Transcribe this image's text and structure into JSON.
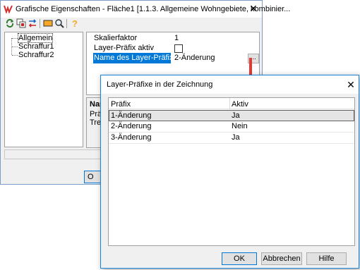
{
  "main_window": {
    "title": "Grafische Eigenschaften - Fläche1 [1.1.3. Allgemeine Wohngebiete, kombinier...",
    "close_label": "✕",
    "toolbar": [
      "refresh-icon",
      "layers-icon",
      "swap-icon",
      "rectangle-icon",
      "zoom-icon",
      "help-icon"
    ],
    "tree": {
      "items": [
        "Allgemein",
        "Schraffur1",
        "Schraffur2"
      ]
    },
    "properties": [
      {
        "name": "Skalierfaktor",
        "value": "1"
      },
      {
        "name": "Layer-Präfix aktiv",
        "value": ""
      },
      {
        "name": "Name des Layer-Präfixes",
        "value": "2-Änderung"
      }
    ],
    "ellipsis_label": "...",
    "description": {
      "title": "Nam",
      "line1": "Präfi",
      "line2": "Tren"
    },
    "ok_label": "O"
  },
  "dialog": {
    "title": "Layer-Präfixe in der Zeichnung",
    "close_label": "✕",
    "columns": [
      "Präfix",
      "Aktiv"
    ],
    "rows": [
      {
        "prefix": "1-Änderung",
        "active": "Ja"
      },
      {
        "prefix": "2-Änderung",
        "active": "Nein"
      },
      {
        "prefix": "3-Änderung",
        "active": "Ja"
      }
    ],
    "buttons": {
      "ok": "OK",
      "cancel": "Abbrechen",
      "help": "Hilfe"
    }
  },
  "colors": {
    "accent": "#0078d7",
    "arrow": "#e53935"
  }
}
